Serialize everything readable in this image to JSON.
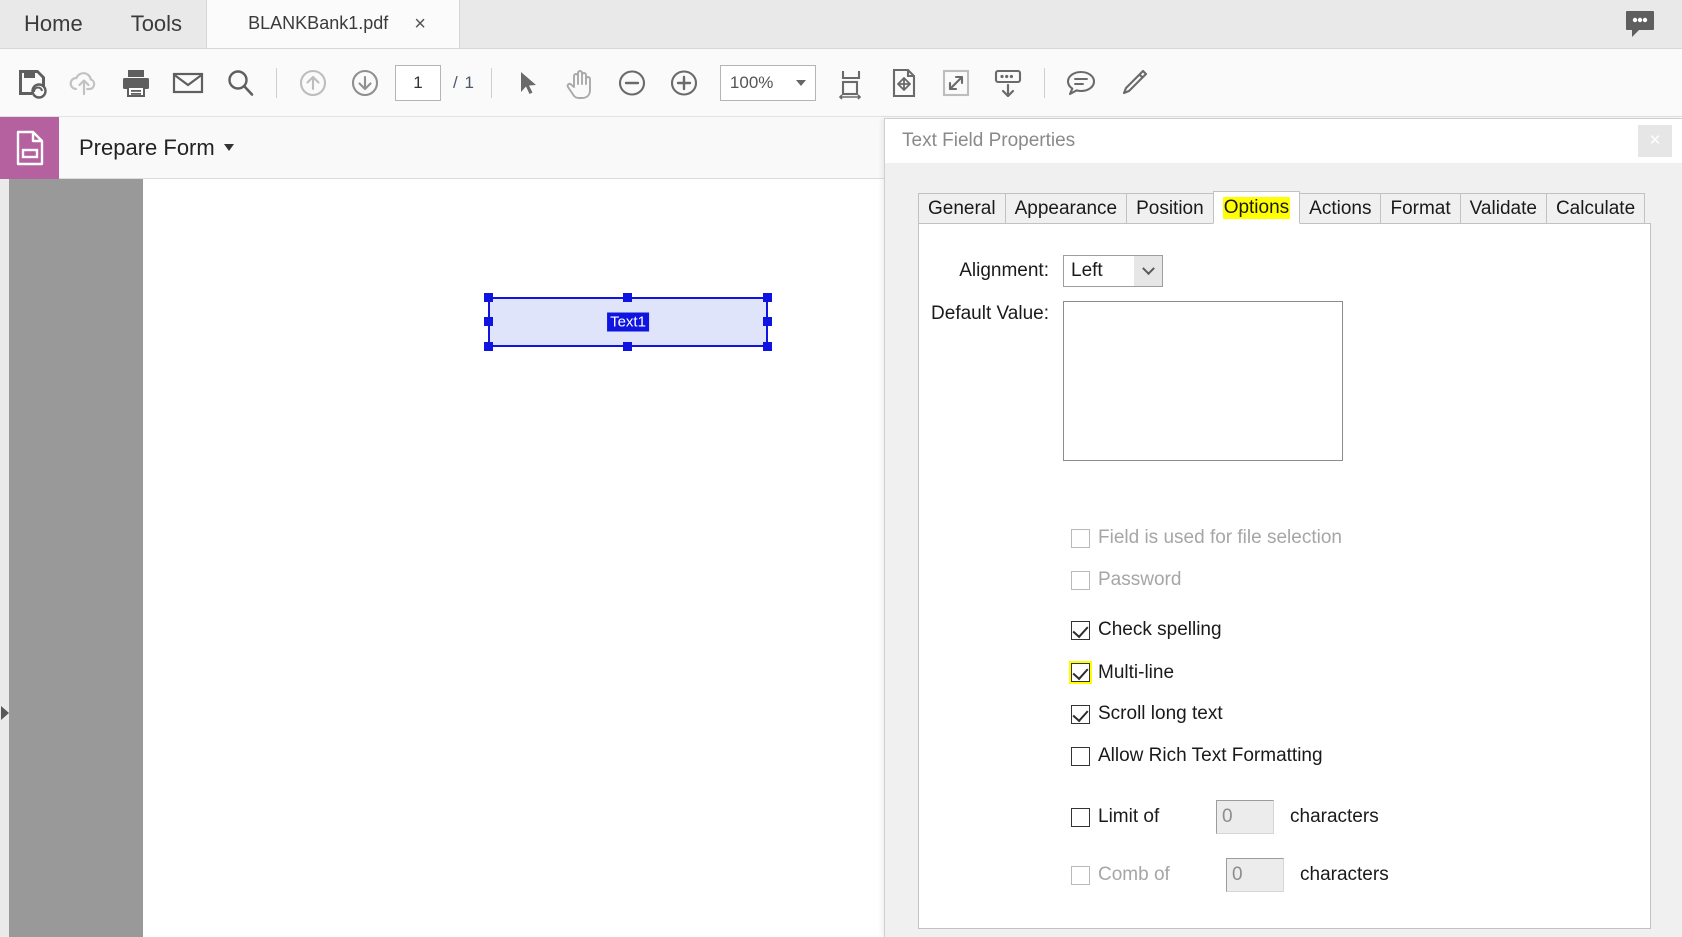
{
  "window": {
    "menus": [
      {
        "label": "Home",
        "name": "menu-home"
      },
      {
        "label": "Tools",
        "name": "menu-tools"
      }
    ],
    "document_tab": {
      "label": "BLANKBank1.pdf",
      "close_glyph": "×"
    },
    "comment_button_icon": "comment-dots-icon"
  },
  "toolbar": {
    "icons": [
      "save-icon",
      "upload-cloud-icon",
      "print-icon",
      "email-icon",
      "search-icon",
      "previous-page-icon",
      "next-page-icon"
    ],
    "page_number": "1",
    "page_count": "/ 1",
    "select_tool_icon": "select-arrow-icon",
    "hand_tool_icon": "hand-icon",
    "zoom_out_icon": "zoom-out-icon",
    "zoom_in_icon": "zoom-in-icon",
    "zoom_level": "100%",
    "fit_page_icon": "fit-page-icon",
    "pan_icon": "pan-document-icon",
    "fullscreen_icon": "fullscreen-icon",
    "scroll_icon": "scroll-down-icon",
    "comment_icon": "comment-icon",
    "highlight_icon": "highlighter-pen-icon"
  },
  "form_bar": {
    "icon": "prepare-form-icon",
    "icon_bg": "#b5609f",
    "title": "Prepare Form",
    "tools": [
      "select-object-icon",
      "text-field-icon",
      "checkbox-field-icon",
      "radio-button-field-icon",
      "list-box-field-icon",
      "dropdown-field-icon",
      "button-field-icon"
    ]
  },
  "document": {
    "left_panel_collapse_icon": "collapse-arrow-icon",
    "field": {
      "name_label": "Text1",
      "selection_color": "#0f14e0",
      "fill_color": "#dfe4fb"
    }
  },
  "dialog": {
    "title": "Text Field Properties",
    "close_glyph": "×",
    "tabs": [
      {
        "label": "General",
        "active": false,
        "highlighted": false
      },
      {
        "label": "Appearance",
        "active": false,
        "highlighted": false
      },
      {
        "label": "Position",
        "active": false,
        "highlighted": false
      },
      {
        "label": "Options",
        "active": true,
        "highlighted": true
      },
      {
        "label": "Actions",
        "active": false,
        "highlighted": false
      },
      {
        "label": "Format",
        "active": false,
        "highlighted": false
      },
      {
        "label": "Validate",
        "active": false,
        "highlighted": false
      },
      {
        "label": "Calculate",
        "active": false,
        "highlighted": false
      }
    ],
    "highlight_color": "#ffff00",
    "options": {
      "alignment_label": "Alignment:",
      "alignment_value": "Left",
      "default_value_label": "Default Value:",
      "default_value": "",
      "checkboxes": [
        {
          "label": "Field is used for file selection",
          "checked": false,
          "disabled": true,
          "highlighted": false
        },
        {
          "label": "Password",
          "checked": false,
          "disabled": true,
          "highlighted": false
        },
        {
          "label": "Check spelling",
          "checked": true,
          "disabled": false,
          "highlighted": false
        },
        {
          "label": "Multi-line",
          "checked": true,
          "disabled": false,
          "highlighted": true
        },
        {
          "label": "Scroll long text",
          "checked": true,
          "disabled": false,
          "highlighted": false
        },
        {
          "label": "Allow Rich Text Formatting",
          "checked": false,
          "disabled": false,
          "highlighted": false
        }
      ],
      "limit_of": {
        "label": "Limit of",
        "checked": false,
        "disabled": false,
        "value": "0",
        "unit": "characters"
      },
      "comb_of": {
        "label": "Comb of",
        "checked": false,
        "disabled": true,
        "value": "0",
        "unit": "characters"
      }
    }
  }
}
